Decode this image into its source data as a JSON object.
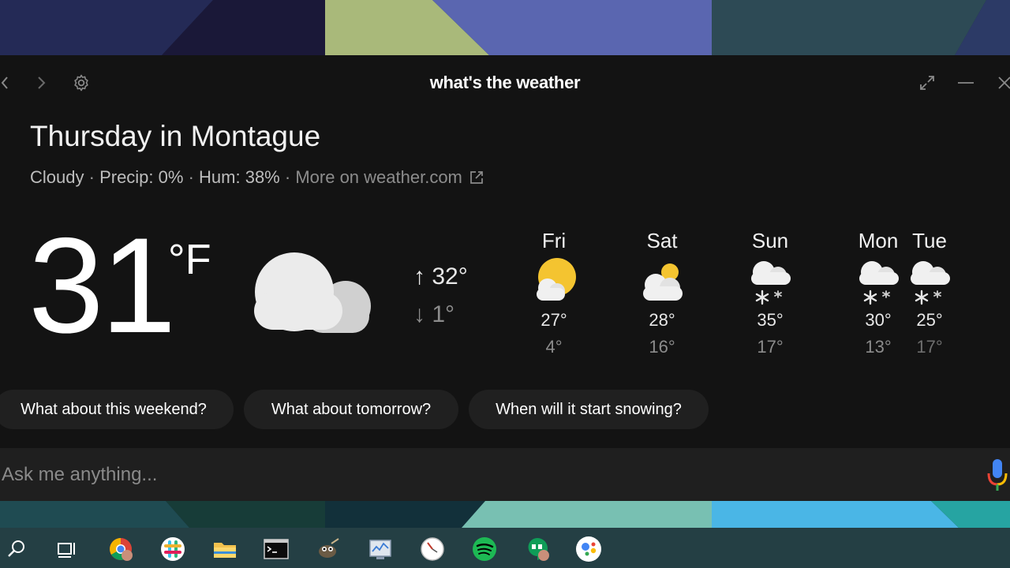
{
  "window": {
    "title": "what's the weather",
    "nav": {
      "back_icon": "chevron-left-icon",
      "forward_icon": "chevron-right-icon",
      "settings_icon": "gear-icon"
    },
    "controls": {
      "expand_icon": "expand-icon",
      "minimize_icon": "minimize-icon",
      "close_icon": "close-icon"
    }
  },
  "weather": {
    "heading": "Thursday in Montague",
    "condition": "Cloudy",
    "separator": "·",
    "precip": "Precip: 0%",
    "humidity": "Hum: 38%",
    "more_link": "More on weather.com",
    "current_temp": "31",
    "unit": "°F",
    "current_icon": "cloud-icon",
    "high": "32°",
    "low": "1°",
    "high_arrow": "↑",
    "low_arrow": "↓"
  },
  "forecast": [
    {
      "day": "Fri",
      "icon": "partly-sunny-icon",
      "high": "27°",
      "low": "4°"
    },
    {
      "day": "Sat",
      "icon": "partly-sunny-icon",
      "high": "28°",
      "low": "16°"
    },
    {
      "day": "Sun",
      "icon": "snow-cloud-icon",
      "high": "35°",
      "low": "17°"
    },
    {
      "day": "Mon",
      "icon": "snow-cloud-icon",
      "high": "30°",
      "low": "13°"
    },
    {
      "day": "Tue",
      "icon": "snow-cloud-icon",
      "high": "25°",
      "low": "17°"
    }
  ],
  "suggestions": [
    "What about this weekend?",
    "What about tomorrow?",
    "When will it start snowing?"
  ],
  "ask": {
    "placeholder": "Ask me anything...",
    "mic_icon": "microphone-icon"
  },
  "taskbar": {
    "apps": [
      "search-icon",
      "task-view-icon",
      "chrome-icon",
      "slack-icon",
      "file-explorer-icon",
      "terminal-icon",
      "gimp-icon",
      "system-monitor-icon",
      "clock-icon",
      "spotify-icon",
      "hangouts-icon",
      "google-assistant-icon"
    ]
  },
  "colors": {
    "window_bg": "#131313",
    "chip_bg": "#202020",
    "sun": "#f4c430",
    "spotify": "#1db954",
    "assistant_blue": "#4285f4",
    "assistant_red": "#ea4335",
    "assistant_yellow": "#fbbc05",
    "assistant_green": "#34a853"
  }
}
